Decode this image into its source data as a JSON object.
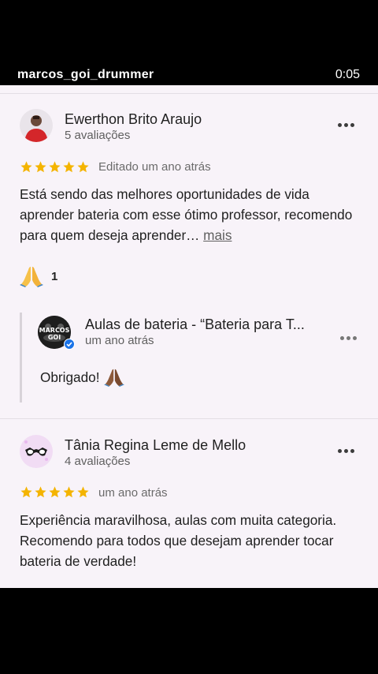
{
  "header": {
    "username": "marcos_goi_drummer",
    "time": "0:05"
  },
  "reviews": [
    {
      "author": "Ewerthon Brito Araujo",
      "review_count": "5 avaliações",
      "rating": 5,
      "date": "Editado um ano atrás",
      "text": "Está sendo das melhores oportunidades de vida aprender bateria com esse ótimo professor, recomendo para quem deseja aprender…",
      "more_label": "mais",
      "reaction": {
        "icon": "praying-hands-icon",
        "count": "1"
      },
      "owner_response": {
        "name": "Aulas de bateria - “Bateria para T...",
        "date": "um ano atrás",
        "text": "Obrigado!",
        "logo_text": "MARCOS GOI"
      }
    },
    {
      "author": "Tânia Regina Leme de Mello",
      "review_count": "4 avaliações",
      "rating": 5,
      "date": "um ano atrás",
      "text": "Experiência maravilhosa, aulas com muita categoria. Recomendo para todos que desejam aprender tocar bateria de verdade!"
    }
  ],
  "colors": {
    "star": "#f4b400",
    "background": "#f8f3f9",
    "verified": "#1a73e8"
  }
}
